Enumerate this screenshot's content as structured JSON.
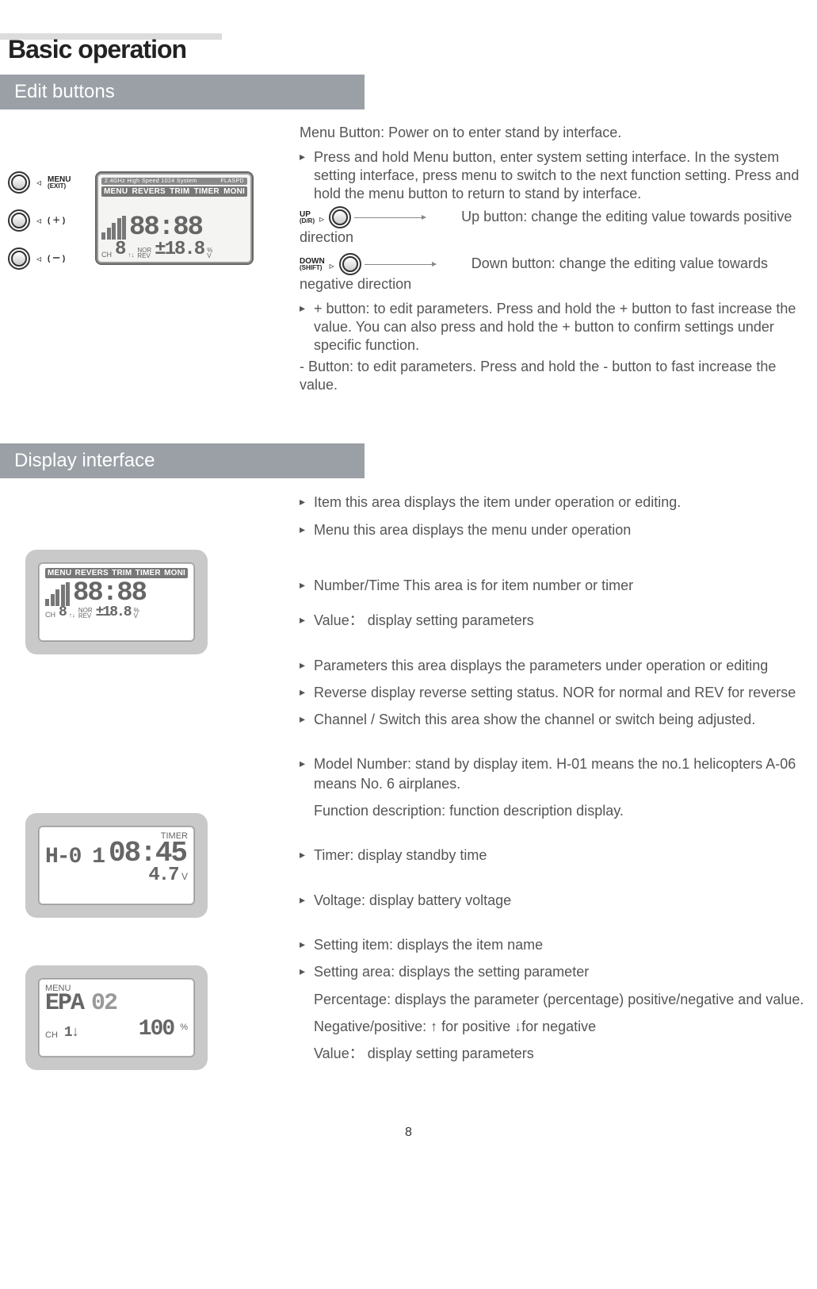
{
  "page": {
    "title": "Basic operation",
    "number": "8"
  },
  "sections": {
    "edit_buttons": {
      "heading": "Edit buttons",
      "menu_button_line": "Menu Button: Power on to enter stand by interface.",
      "menu_button_para": "Press and hold Menu button, enter system setting interface. In the system setting interface, press menu to switch to the next function setting. Press and hold the menu button to return to stand by interface.",
      "up_label": "UP",
      "up_sub": "(D/R)",
      "up_text": "Up button: change the editing value towards positive direction",
      "down_label": "DOWN",
      "down_sub": "(SHIFT)",
      "down_text": "Down button: change the editing value towards negative direction",
      "plus_text": "+ button: to edit parameters. Press and hold the + button to fast increase the value. You can also press and hold the + button to confirm settings under specific function.",
      "minus_text": "- Button:  to edit parameters. Press and hold the - button to fast increase the value.",
      "dial_labels": {
        "menu": "MENU",
        "menu_sub": "(EXIT)",
        "plus": "( ＋ )",
        "minus": "( ー )"
      },
      "lcd": {
        "topbar_left": "2.4GHz High Speed 1024 System",
        "topbar_right": "FLASPD",
        "menus": [
          "MENU",
          "REVERS",
          "TRIM",
          "TIMER",
          "MONI"
        ],
        "big_time": "88:88",
        "ch_label": "CH",
        "ch_digit": "8",
        "nor": "NOR",
        "rev": "REV",
        "value": "±18.8",
        "pct": "%",
        "v": "V"
      }
    },
    "display_interface": {
      "heading": "Display interface",
      "items": {
        "item": "Item  this area displays the item under operation or editing.",
        "menu": "Menu  this area displays the menu under operation",
        "number_time": "Number/Time This area is for item number or timer",
        "value1": "Value： display setting parameters",
        "parameters": "Parameters   this area displays the parameters under operation or editing",
        "reverse": "Reverse  display reverse setting status. NOR for normal and REV for reverse",
        "channel": "Channel / Switch  this area show the channel or switch being adjusted.",
        "model_number": "Model  Number: stand by display item. H-01 means the no.1 helicopters A-06 means No. 6 airplanes.",
        "function_desc": "Function description: function description display.",
        "timer": "Timer: display standby time",
        "voltage": "Voltage: display battery voltage",
        "setting_item": "Setting item: displays the item name",
        "setting_area": "Setting area: displays the setting parameter",
        "percentage": "Percentage: displays the parameter (percentage) positive/negative and value.",
        "neg_pos": "Negative/positive: ↑ for positive ↓for negative",
        "value2": "Value： display setting parameters"
      },
      "lcd1": {
        "menus": [
          "MENU",
          "REVERS",
          "TRIM",
          "TIMER",
          "MONI"
        ],
        "big_time": "88:88",
        "ch_label": "CH",
        "ch_digit": "8",
        "nor": "NOR",
        "rev": "REV",
        "value": "±18.8",
        "pct": "%",
        "v": "V"
      },
      "lcd2": {
        "timer_label": "TIMER",
        "model": "H-0 1",
        "time": "08:45",
        "volt": "4.7",
        "v": "V"
      },
      "lcd3": {
        "menu_label": "MENU",
        "item": "EPA",
        "num": "02",
        "ch_label": "CH",
        "ch_arrow": "1↓",
        "value": "100",
        "pct": "%"
      }
    }
  }
}
